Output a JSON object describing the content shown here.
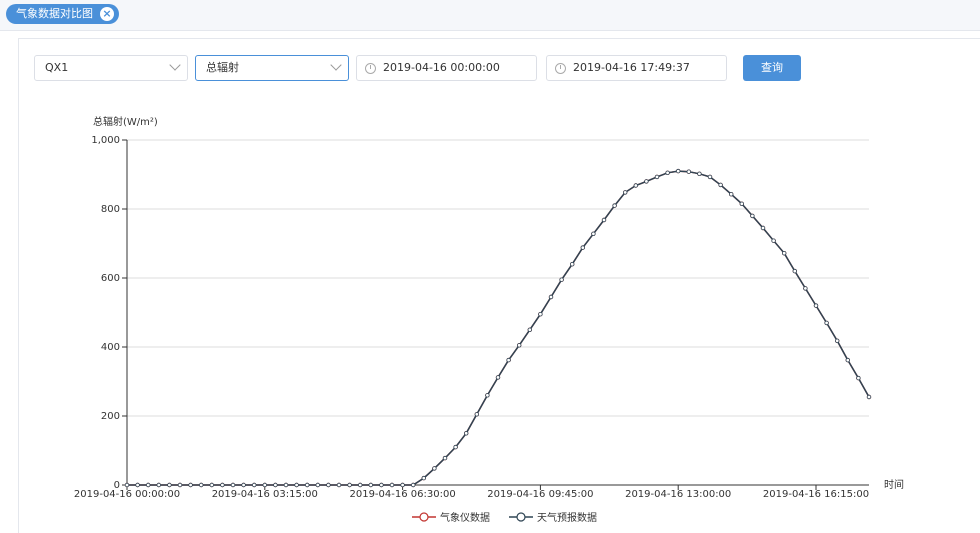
{
  "tab": {
    "label": "气象数据对比图",
    "close_glyph": "×"
  },
  "filters": {
    "station": "QX1",
    "metric": "总辐射",
    "start_time": "2019-04-16 00:00:00",
    "end_time": "2019-04-16 17:49:37",
    "query_label": "查询"
  },
  "chart_data": {
    "type": "line",
    "ylabel": "总辐射(W/m²)",
    "xlabel": "时间",
    "ylim": [
      0,
      1000
    ],
    "y_ticks": [
      "0",
      "200",
      "400",
      "600",
      "800",
      "1,000"
    ],
    "x_tick_labels": [
      "2019-04-16 00:00:00",
      "2019-04-16 03:15:00",
      "2019-04-16 06:30:00",
      "2019-04-16 09:45:00",
      "2019-04-16 13:00:00",
      "2019-04-16 16:15:00"
    ],
    "x_tick_indices": [
      0,
      13,
      26,
      39,
      52,
      65
    ],
    "x_count": 71,
    "grid": "horizontal",
    "legend_position": "bottom-center",
    "series": [
      {
        "name": "气象仪数据",
        "color": "#c23531",
        "values": [
          0,
          0,
          0,
          0,
          0,
          0,
          0,
          0,
          0,
          0,
          0,
          0,
          0,
          0,
          0,
          0,
          0,
          0,
          0,
          0,
          0,
          0,
          0,
          0,
          0,
          0,
          0,
          0,
          20,
          48,
          78,
          110,
          150,
          205,
          260,
          312,
          362,
          405,
          450,
          495,
          545,
          595,
          640,
          688,
          728,
          768,
          810,
          848,
          868,
          880,
          893,
          905,
          910,
          908,
          902,
          893,
          870,
          843,
          815,
          780,
          745,
          708,
          672,
          620,
          570,
          520,
          470,
          418,
          362,
          310,
          255
        ]
      },
      {
        "name": "天气预报数据",
        "color": "#2f4554",
        "values": [
          0,
          0,
          0,
          0,
          0,
          0,
          0,
          0,
          0,
          0,
          0,
          0,
          0,
          0,
          0,
          0,
          0,
          0,
          0,
          0,
          0,
          0,
          0,
          0,
          0,
          0,
          0,
          0,
          20,
          48,
          78,
          110,
          150,
          205,
          260,
          312,
          362,
          405,
          450,
          495,
          545,
          595,
          640,
          688,
          728,
          768,
          810,
          848,
          868,
          880,
          893,
          905,
          910,
          908,
          902,
          893,
          870,
          843,
          815,
          780,
          745,
          708,
          672,
          620,
          570,
          520,
          470,
          418,
          362,
          310,
          255
        ]
      }
    ]
  }
}
